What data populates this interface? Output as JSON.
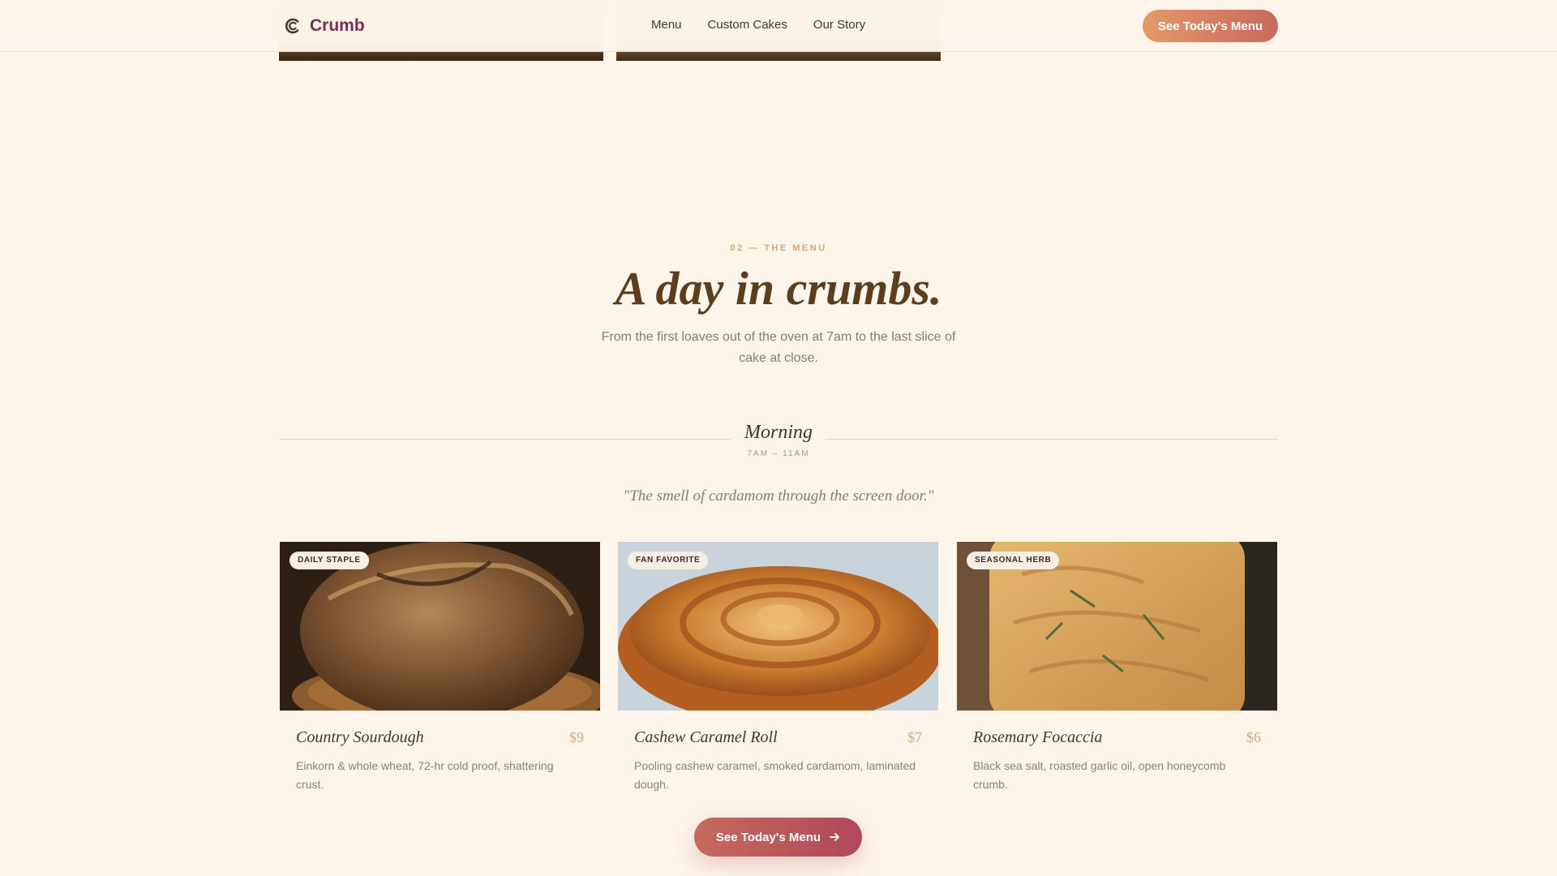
{
  "brand": {
    "name": "Crumb",
    "logo_icon": "c-logo-icon"
  },
  "nav": {
    "items": [
      "Menu",
      "Custom Cakes",
      "Our Story"
    ]
  },
  "header": {
    "cta_label": "See Today's Menu"
  },
  "section": {
    "eyebrow": "02 — THE MENU",
    "title": "A day in crumbs.",
    "lead": "From the first loaves out of the oven at 7am to the last slice of cake at close."
  },
  "period": {
    "name": "Morning",
    "hours": "7AM – 11AM",
    "quote": "\"The smell of cardamom through the screen door.\""
  },
  "items": [
    {
      "badge": "DAILY STAPLE",
      "name": "Country Sourdough",
      "price": "$9",
      "description": "Einkorn & whole wheat, 72-hr cold proof, shattering crust."
    },
    {
      "badge": "FAN FAVORITE",
      "name": "Cashew Caramel Roll",
      "price": "$7",
      "description": "Pooling cashew caramel, smoked cardamom, laminated dough."
    },
    {
      "badge": "SEASONAL HERB",
      "name": "Rosemary Focaccia",
      "price": "$6",
      "description": "Black sea salt, roasted garlic oil, open honeycomb crumb."
    }
  ],
  "cta": {
    "label": "See Today's Menu",
    "icon": "arrow-right-icon"
  },
  "colors": {
    "accent": "#d6a877",
    "brand": "#7a2e50",
    "cta_start": "#c56a5c",
    "cta_end": "#b0485a",
    "background": "#fdf5ea"
  }
}
